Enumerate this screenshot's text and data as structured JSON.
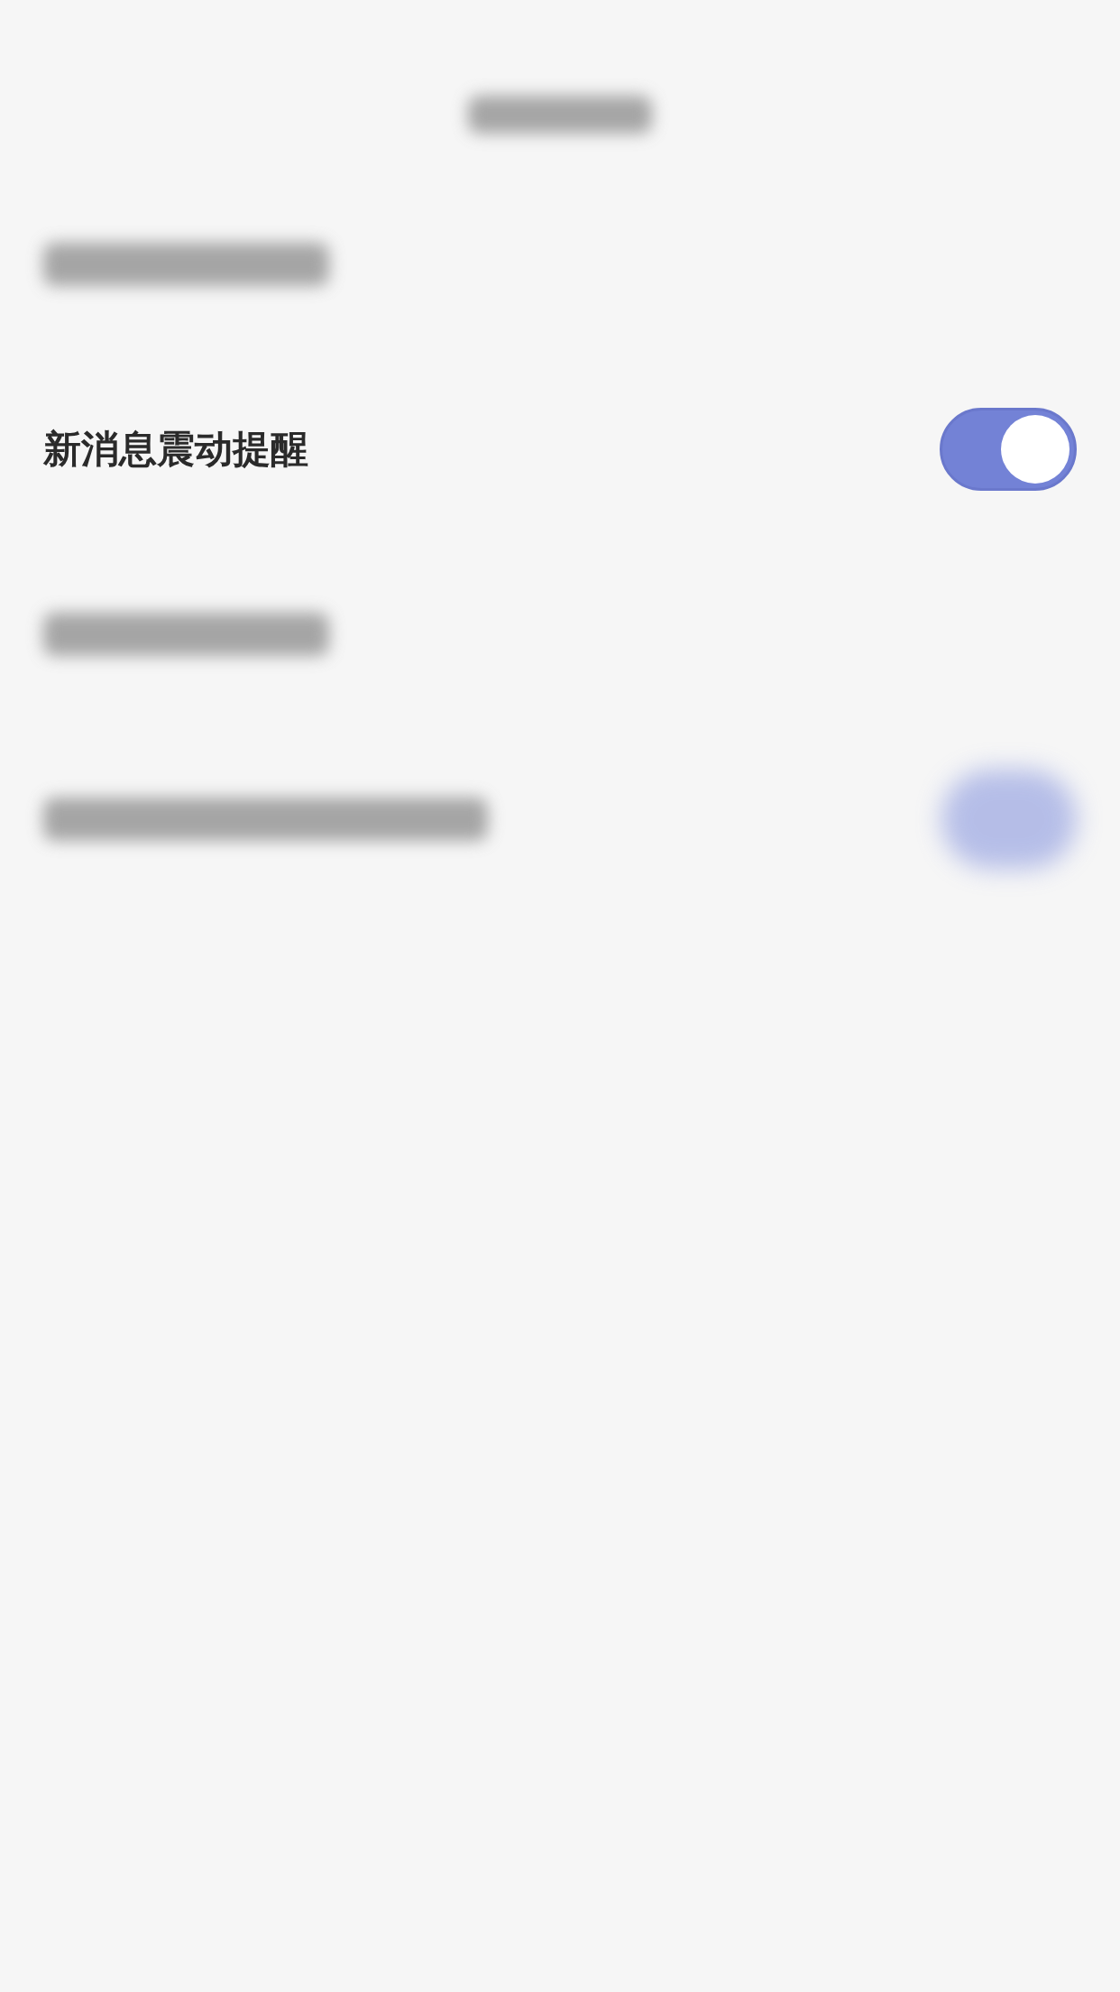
{
  "settings": [
    {
      "label": "新消息震动提醒",
      "on": true
    }
  ],
  "blurred_switch": {
    "on": true
  }
}
